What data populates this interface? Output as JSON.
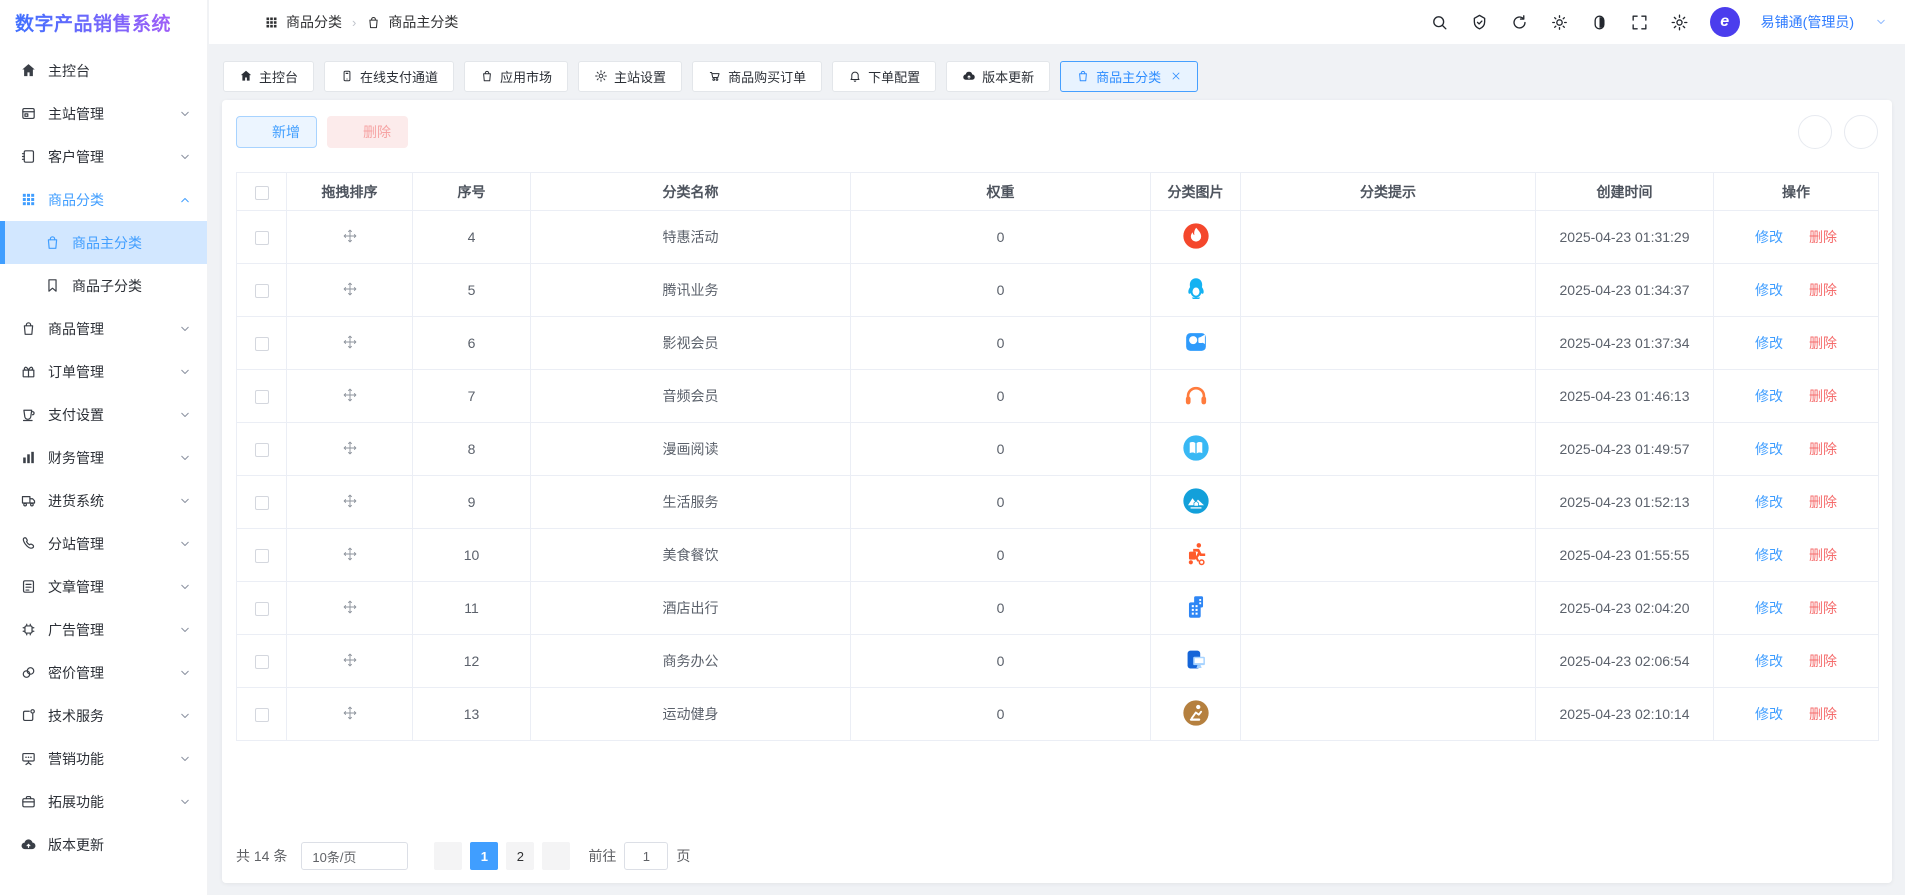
{
  "app": {
    "title": "数字产品销售系统"
  },
  "header": {
    "breadcrumb": [
      {
        "label": "商品分类",
        "icon": "grid-icon"
      },
      {
        "label": "商品主分类",
        "icon": "bag-icon"
      }
    ],
    "action_icons": [
      "search-icon",
      "badge-icon",
      "refresh-icon",
      "sun-icon",
      "theme-toggle-icon",
      "fullscreen-icon",
      "gear-icon"
    ],
    "user": {
      "name": "易铺通(管理员)",
      "avatar_letter": "e"
    }
  },
  "sidebar": {
    "items": [
      {
        "label": "主控台",
        "icon": "home-icon"
      },
      {
        "label": "主站管理",
        "icon": "window-icon",
        "chevron": "down"
      },
      {
        "label": "客户管理",
        "icon": "notebook-icon",
        "chevron": "down"
      },
      {
        "label": "商品分类",
        "icon": "grid-icon",
        "chevron": "up",
        "active": true,
        "children": [
          {
            "label": "商品主分类",
            "icon": "bag-icon",
            "selected": true
          },
          {
            "label": "商品子分类",
            "icon": "bookmark-icon"
          }
        ]
      },
      {
        "label": "商品管理",
        "icon": "bag-icon",
        "chevron": "down"
      },
      {
        "label": "订单管理",
        "icon": "gift-icon",
        "chevron": "down"
      },
      {
        "label": "支付设置",
        "icon": "cup-icon",
        "chevron": "down"
      },
      {
        "label": "财务管理",
        "icon": "chart-icon",
        "chevron": "down"
      },
      {
        "label": "进货系统",
        "icon": "truck-icon",
        "chevron": "down"
      },
      {
        "label": "分站管理",
        "icon": "phone-icon",
        "chevron": "down"
      },
      {
        "label": "文章管理",
        "icon": "article-icon",
        "chevron": "down"
      },
      {
        "label": "广告管理",
        "icon": "chip-icon",
        "chevron": "down"
      },
      {
        "label": "密价管理",
        "icon": "link-icon",
        "chevron": "down"
      },
      {
        "label": "技术服务",
        "icon": "service-icon",
        "chevron": "down"
      },
      {
        "label": "营销功能",
        "icon": "board-icon",
        "chevron": "down"
      },
      {
        "label": "拓展功能",
        "icon": "briefcase-icon",
        "chevron": "down"
      },
      {
        "label": "版本更新",
        "icon": "cloud-icon"
      }
    ]
  },
  "tabs": [
    {
      "label": "主控台",
      "icon": "home-icon"
    },
    {
      "label": "在线支付通道",
      "icon": "card-icon"
    },
    {
      "label": "应用市场",
      "icon": "bag-icon"
    },
    {
      "label": "主站设置",
      "icon": "gear-icon"
    },
    {
      "label": "商品购买订单",
      "icon": "order-icon"
    },
    {
      "label": "下单配置",
      "icon": "bell-icon"
    },
    {
      "label": "版本更新",
      "icon": "cloud-icon"
    },
    {
      "label": "商品主分类",
      "icon": "bag-icon",
      "active": true,
      "closable": true
    }
  ],
  "toolbar": {
    "add_label": "新增",
    "delete_label": "删除"
  },
  "table": {
    "columns": [
      "拖拽排序",
      "序号",
      "分类名称",
      "权重",
      "分类图片",
      "分类提示",
      "创建时间",
      "操作"
    ],
    "actions": {
      "edit": "修改",
      "delete": "删除"
    },
    "rows": [
      {
        "seq": "4",
        "name": "特惠活动",
        "weight": "0",
        "icon": "flame-icon",
        "tip": "",
        "created": "2025-04-23 01:31:29"
      },
      {
        "seq": "5",
        "name": "腾讯业务",
        "weight": "0",
        "icon": "qq-penguin-icon",
        "tip": "",
        "created": "2025-04-23 01:34:37"
      },
      {
        "seq": "6",
        "name": "影视会员",
        "weight": "0",
        "icon": "video-icon",
        "tip": "",
        "created": "2025-04-23 01:37:34"
      },
      {
        "seq": "7",
        "name": "音频会员",
        "weight": "0",
        "icon": "headphones-icon",
        "tip": "",
        "created": "2025-04-23 01:46:13"
      },
      {
        "seq": "8",
        "name": "漫画阅读",
        "weight": "0",
        "icon": "book-icon",
        "tip": "",
        "created": "2025-04-23 01:49:57"
      },
      {
        "seq": "9",
        "name": "生活服务",
        "weight": "0",
        "icon": "life-icon",
        "tip": "",
        "created": "2025-04-23 01:52:13"
      },
      {
        "seq": "10",
        "name": "美食餐饮",
        "weight": "0",
        "icon": "food-delivery-icon",
        "tip": "",
        "created": "2025-04-23 01:55:55"
      },
      {
        "seq": "11",
        "name": "酒店出行",
        "weight": "0",
        "icon": "hotel-icon",
        "tip": "",
        "created": "2025-04-23 02:04:20"
      },
      {
        "seq": "12",
        "name": "商务办公",
        "weight": "0",
        "icon": "office-icon",
        "tip": "",
        "created": "2025-04-23 02:06:54"
      },
      {
        "seq": "13",
        "name": "运动健身",
        "weight": "0",
        "icon": "fitness-icon",
        "tip": "",
        "created": "2025-04-23 02:10:14"
      }
    ]
  },
  "pagination": {
    "total": "共 14 条",
    "page_size": "10条/页",
    "pages": [
      "1",
      "2"
    ],
    "active_page": "1",
    "goto_label": "前往",
    "goto_value": "1",
    "goto_unit": "页"
  },
  "colors": {
    "primary": "#409eff",
    "danger": "#f56c6c",
    "selected_bg": "#d2e7ff",
    "active_tab_bg": "#e8f3ff"
  }
}
